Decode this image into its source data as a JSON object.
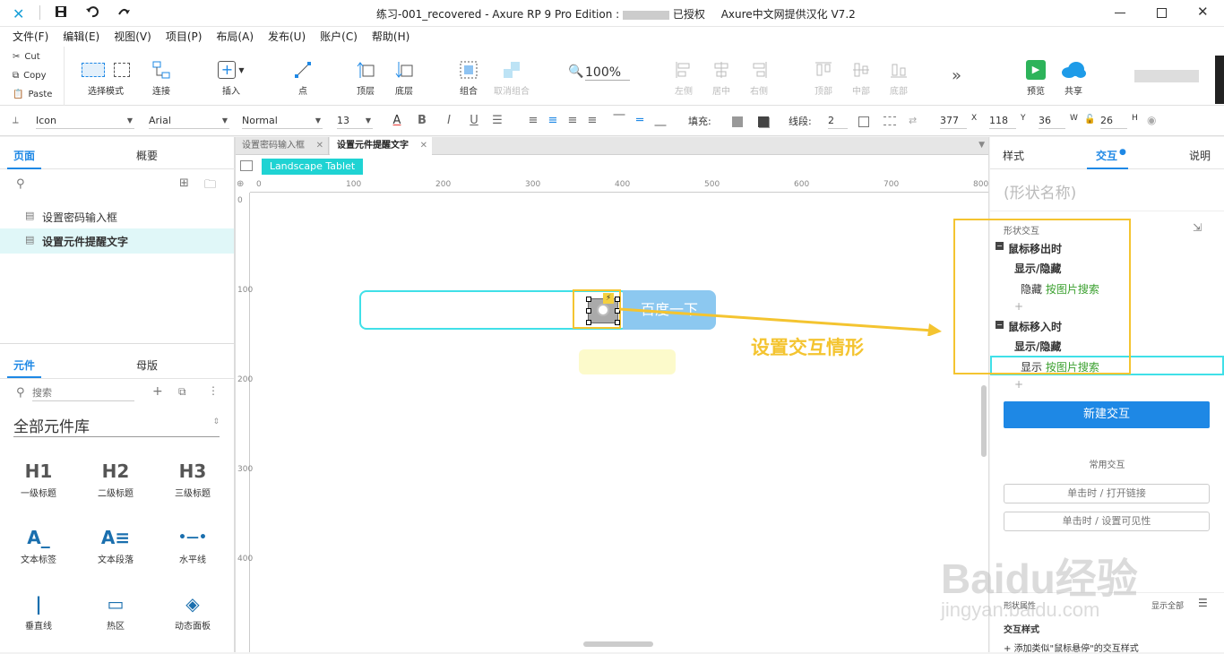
{
  "window": {
    "title": "练习-001_recovered - Axure RP 9 Pro Edition : ",
    "title_extra": "已授权",
    "title_right": "Axure中文网提供汉化 V7.2"
  },
  "menu": [
    "文件(F)",
    "编辑(E)",
    "视图(V)",
    "项目(P)",
    "布局(A)",
    "发布(U)",
    "账户(C)",
    "帮助(H)"
  ],
  "clipboard": {
    "cut": "Cut",
    "copy": "Copy",
    "paste": "Paste"
  },
  "toolbar": {
    "select_mode": "选择模式",
    "connect": "连接",
    "insert": "插入",
    "point": "点",
    "top": "顶层",
    "bottom": "底层",
    "group": "组合",
    "ungroup": "取消组合",
    "zoom": "100%",
    "align_left": "左侧",
    "align_center": "居中",
    "align_right": "右侧",
    "align_top": "顶部",
    "align_middle": "中部",
    "align_bottom": "底部",
    "more": "»",
    "preview": "预览",
    "share": "共享"
  },
  "format": {
    "icon_style": "Icon",
    "font": "Arial",
    "weight": "Normal",
    "size": "13",
    "fill_label": "填充:",
    "stroke_label": "线段:",
    "stroke_value": "2",
    "x": "377",
    "x_label": "X",
    "y": "118",
    "y_label": "Y",
    "w": "36",
    "w_label": "W",
    "h": "26",
    "h_label": "H"
  },
  "pages_panel": {
    "tab_pages": "页面",
    "tab_outline": "概要",
    "pages": [
      "设置密码输入框",
      "设置元件提醒文字"
    ]
  },
  "library_panel": {
    "tab_widgets": "元件",
    "tab_masters": "母版",
    "search_placeholder": "搜索",
    "library_name": "全部元件库",
    "items": [
      {
        "big": "H1",
        "label": "一级标题"
      },
      {
        "big": "H2",
        "label": "二级标题"
      },
      {
        "big": "H3",
        "label": "三级标题"
      },
      {
        "big": "A_",
        "label": "文本标签"
      },
      {
        "big": "A≡",
        "label": "文本段落"
      },
      {
        "big": "•—•",
        "label": "水平线"
      },
      {
        "big": "|",
        "label": "垂直线"
      },
      {
        "big": "▭",
        "label": "热区"
      },
      {
        "big": "◈",
        "label": "动态面板"
      }
    ]
  },
  "canvas": {
    "tabs": [
      "设置密码输入框",
      "设置元件提醒文字"
    ],
    "device_label": "Landscape Tablet",
    "ruler_h": [
      "0",
      "100",
      "200",
      "300",
      "400",
      "500",
      "600",
      "700",
      "800"
    ],
    "ruler_v": [
      "0",
      "100",
      "200",
      "300",
      "400"
    ],
    "search_button_text": "百度一下",
    "annotation_text": "设置交互情形"
  },
  "right_panel": {
    "tab_style": "样式",
    "tab_interactions": "交互",
    "tab_notes": "说明",
    "shape_name_placeholder": "(形状名称)",
    "section_label": "形状交互",
    "events": [
      {
        "event": "鼠标移出时",
        "action": "显示/隐藏",
        "verb": "隐藏",
        "target": "按图片搜索"
      },
      {
        "event": "鼠标移入时",
        "action": "显示/隐藏",
        "verb": "显示",
        "target": "按图片搜索"
      }
    ],
    "new_interaction": "新建交互",
    "common_label": "常用交互",
    "common_buttons": [
      "单击时 / 打开链接",
      "单击时 / 设置可见性"
    ],
    "properties_label": "形状属性",
    "show_all": "显示全部",
    "interaction_style_label": "交互样式",
    "add_style": "添加类似\"鼠标悬停\"的交互样式"
  },
  "watermark": {
    "brand": "Baidu经验",
    "url": "jingyan.baidu.com"
  },
  "colors": {
    "accent": "#1e88e5",
    "cyan": "#1fd3d3",
    "yellow": "#f4c430",
    "search_blue": "#8cc8f0",
    "green_link": "#3aa02e"
  }
}
